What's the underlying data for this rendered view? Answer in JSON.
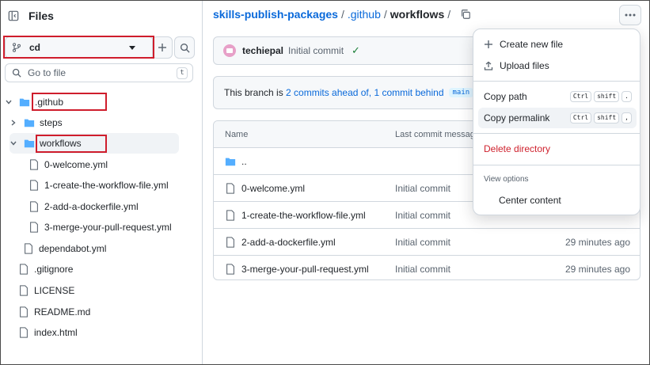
{
  "sidebar": {
    "title": "Files",
    "branch": "cd",
    "goto_placeholder": "Go to file",
    "goto_shortcut": "t",
    "tree": [
      {
        "label": ".github",
        "type": "folder",
        "expanded": true
      },
      {
        "label": "steps",
        "type": "folder",
        "expanded": false
      },
      {
        "label": "workflows",
        "type": "folder",
        "expanded": true
      },
      {
        "label": "0-welcome.yml",
        "type": "file"
      },
      {
        "label": "1-create-the-workflow-file.yml",
        "type": "file"
      },
      {
        "label": "2-add-a-dockerfile.yml",
        "type": "file"
      },
      {
        "label": "3-merge-your-pull-request.yml",
        "type": "file"
      },
      {
        "label": "dependabot.yml",
        "type": "file"
      },
      {
        "label": ".gitignore",
        "type": "file"
      },
      {
        "label": "LICENSE",
        "type": "file"
      },
      {
        "label": "README.md",
        "type": "file"
      },
      {
        "label": "index.html",
        "type": "file"
      }
    ]
  },
  "breadcrumb": {
    "repo": "skills-publish-packages",
    "sep": "/",
    "folder": ".github",
    "current": "workflows"
  },
  "commit": {
    "author": "techiepal",
    "message": "Initial commit",
    "status": "✓"
  },
  "ahead": {
    "prefix": "This branch is",
    "ahead_link": "2 commits ahead of,",
    "behind_link": "1 commit behind",
    "base_branch": "main",
    "suffix": "."
  },
  "table": {
    "col_name": "Name",
    "col_msg": "Last commit message",
    "parent": "..",
    "rows": [
      {
        "name": "0-welcome.yml",
        "msg": "Initial commit",
        "age": ""
      },
      {
        "name": "1-create-the-workflow-file.yml",
        "msg": "Initial commit",
        "age": ""
      },
      {
        "name": "2-add-a-dockerfile.yml",
        "msg": "Initial commit",
        "age": "29 minutes ago"
      },
      {
        "name": "3-merge-your-pull-request.yml",
        "msg": "Initial commit",
        "age": "29 minutes ago"
      }
    ]
  },
  "menu": {
    "create_new_file": "Create new file",
    "upload_files": "Upload files",
    "copy_path": "Copy path",
    "copy_path_keys": [
      "Ctrl",
      "shift",
      "."
    ],
    "copy_permalink": "Copy permalink",
    "copy_permalink_keys": [
      "Ctrl",
      "shift",
      ","
    ],
    "delete_directory": "Delete directory",
    "view_options": "View options",
    "center_content": "Center content"
  },
  "colors": {
    "accent": "#0969da",
    "highlight_box": "#cf1d2c",
    "danger": "#cf222e",
    "folder": "#54aeff"
  }
}
